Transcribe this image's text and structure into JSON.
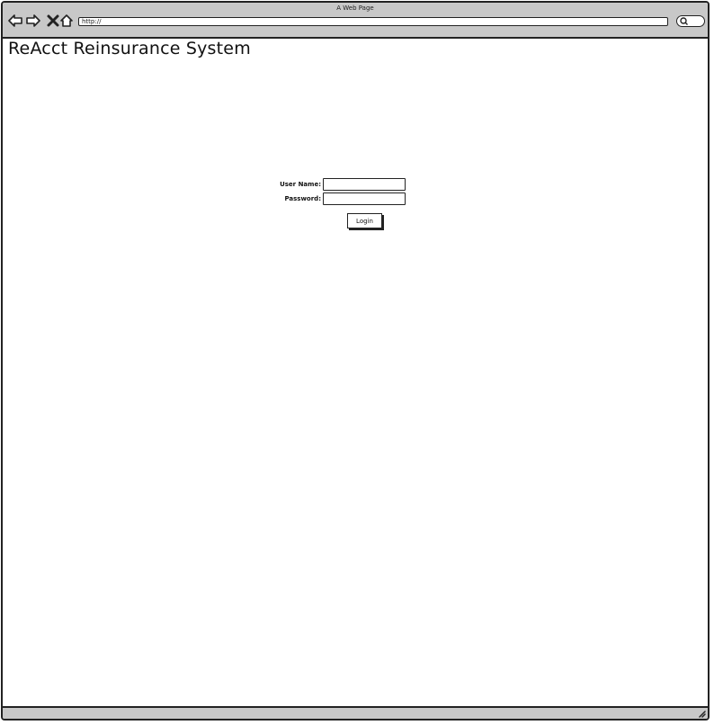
{
  "window": {
    "title": "A Web Page"
  },
  "browser": {
    "address": "http://",
    "icons": {
      "back": "back-arrow-icon",
      "forward": "forward-arrow-icon",
      "stop": "close-icon",
      "home": "home-icon",
      "search": "search-icon",
      "resize": "resize-grip-icon"
    }
  },
  "page": {
    "title": "ReAcct Reinsurance System"
  },
  "login_form": {
    "username_label": "User Name:",
    "username_value": "",
    "password_label": "Password:",
    "password_value": "",
    "login_label": "Login"
  },
  "colors": {
    "chrome": "#c8c8c8",
    "border": "#222222",
    "background": "#ffffff"
  }
}
